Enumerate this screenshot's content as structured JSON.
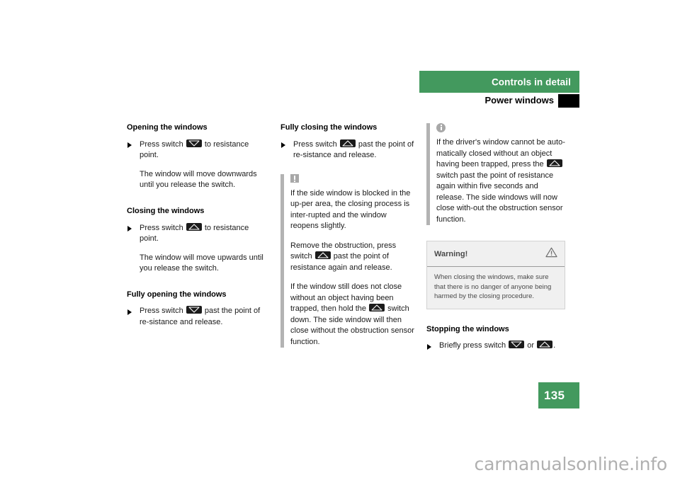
{
  "header": {
    "chapter_title": "Controls in detail",
    "section_title": "Power windows",
    "green_color": "#43995E"
  },
  "page_number": "135",
  "watermark": "carmanualsonline.info",
  "icons": {
    "switch_down": "window-switch-down-icon",
    "switch_up": "window-switch-up-icon",
    "note": "exclamation-note-icon",
    "info": "information-icon",
    "warning": "warning-triangle-icon",
    "bullet": "bullet-triangle-icon"
  },
  "column_left": {
    "sections": [
      {
        "heading": "Opening the windows",
        "bullet_pre": "Press switch",
        "bullet_switch": "down",
        "bullet_post": "to resistance point.",
        "follow": "The window will move downwards until you release the switch."
      },
      {
        "heading": "Closing the windows",
        "bullet_pre": "Press switch",
        "bullet_switch": "up",
        "bullet_post": "to resistance point.",
        "follow": "The window will move upwards until you release the switch."
      },
      {
        "heading": "Fully opening the windows",
        "bullet_pre": "Press switch",
        "bullet_switch": "down",
        "bullet_post": "past the point of re-sistance and release.",
        "follow": ""
      }
    ]
  },
  "column_middle": {
    "heading": "Fully closing the windows",
    "bullet_pre": "Press switch",
    "bullet_post": "past the point of re-sistance and release.",
    "note": {
      "paragraph_1": "If the side window is blocked in the up-per area, the closing process is inter-rupted and the window reopens slightly.",
      "paragraph_2_pre": "Remove the obstruction, press switch",
      "paragraph_2_post": "past the point of resistance again and release.",
      "paragraph_3_pre": "If the window still does not close without an object having been trapped, then hold the",
      "paragraph_3_post": "switch down. The side window will then close without the obstruction sensor function."
    }
  },
  "column_right": {
    "info": {
      "text_pre": "If the driver's window cannot be auto-matically closed without an object having been trapped, press the",
      "text_post": "switch past the point of resistance again within five seconds and release. The side windows will now close with-out the obstruction sensor function."
    },
    "warning": {
      "title": "Warning!",
      "body": "When closing the windows, make sure that there is no danger of anyone being harmed by the closing procedure."
    },
    "stopping": {
      "heading": "Stopping the windows",
      "bullet_pre": "Briefly press switch",
      "bullet_mid": "or",
      "bullet_post": "."
    }
  }
}
